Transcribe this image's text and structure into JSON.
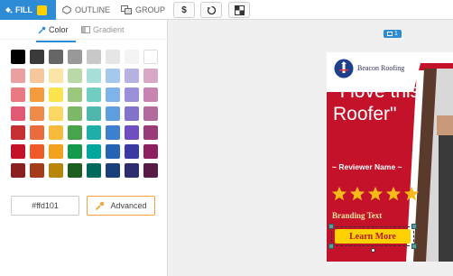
{
  "toolbar": {
    "fill_label": "FILL",
    "fill_color": "#ffd101",
    "outline_label": "OUTLINE",
    "group_label": "GROUP",
    "dollar_label": "$"
  },
  "panel": {
    "tabs": [
      {
        "label": "Color",
        "icon": "dropper-icon"
      },
      {
        "label": "Gradient",
        "icon": "gradient-icon"
      }
    ],
    "swatches": [
      [
        "#000000",
        "#3a3a3a",
        "#666666",
        "#999999",
        "#c8c8c8",
        "#e6e6e6",
        "#f3f3f3",
        "#ffffff"
      ],
      [
        "#e8a0a0",
        "#f6c79b",
        "#fbe5a6",
        "#b9d9a9",
        "#a7ded5",
        "#a5c8ef",
        "#b8b2e3",
        "#d9a8c6"
      ],
      [
        "#e97a82",
        "#f39b3d",
        "#fce44e",
        "#9bc77d",
        "#71cdc2",
        "#7eb4ea",
        "#9a90d9",
        "#c883b2"
      ],
      [
        "#e05a73",
        "#ef8a48",
        "#fbd764",
        "#7cb866",
        "#4fb7ad",
        "#5f9fe0",
        "#8272c9",
        "#b36b9e"
      ],
      [
        "#c43033",
        "#ea6b3e",
        "#f6bb3d",
        "#48a44b",
        "#1faea8",
        "#3d80cf",
        "#6f4fbf",
        "#9a3b78"
      ],
      [
        "#c4122a",
        "#ef5a28",
        "#f2a21f",
        "#14984b",
        "#00a59c",
        "#2563b5",
        "#3a3aa0",
        "#8e1f61"
      ],
      [
        "#8a1f1f",
        "#a63b1b",
        "#b8860b",
        "#1b5e20",
        "#00695c",
        "#1a3f7a",
        "#2c2c6e",
        "#5a1a47"
      ]
    ],
    "hex_value": "#ffd101",
    "advanced_label": "Advanced"
  },
  "canvas": {
    "page_number": "1",
    "design": {
      "brand_name": "Beacon Roofing",
      "quote": "\"I love this Roofer\"",
      "reviewer": "~ Reviewer Name ~",
      "stars": 5,
      "branding_text": "Branding Text",
      "cta_label": "Learn More",
      "bg_red": "#c4122a",
      "accent_brown": "#5a3a2a"
    }
  }
}
